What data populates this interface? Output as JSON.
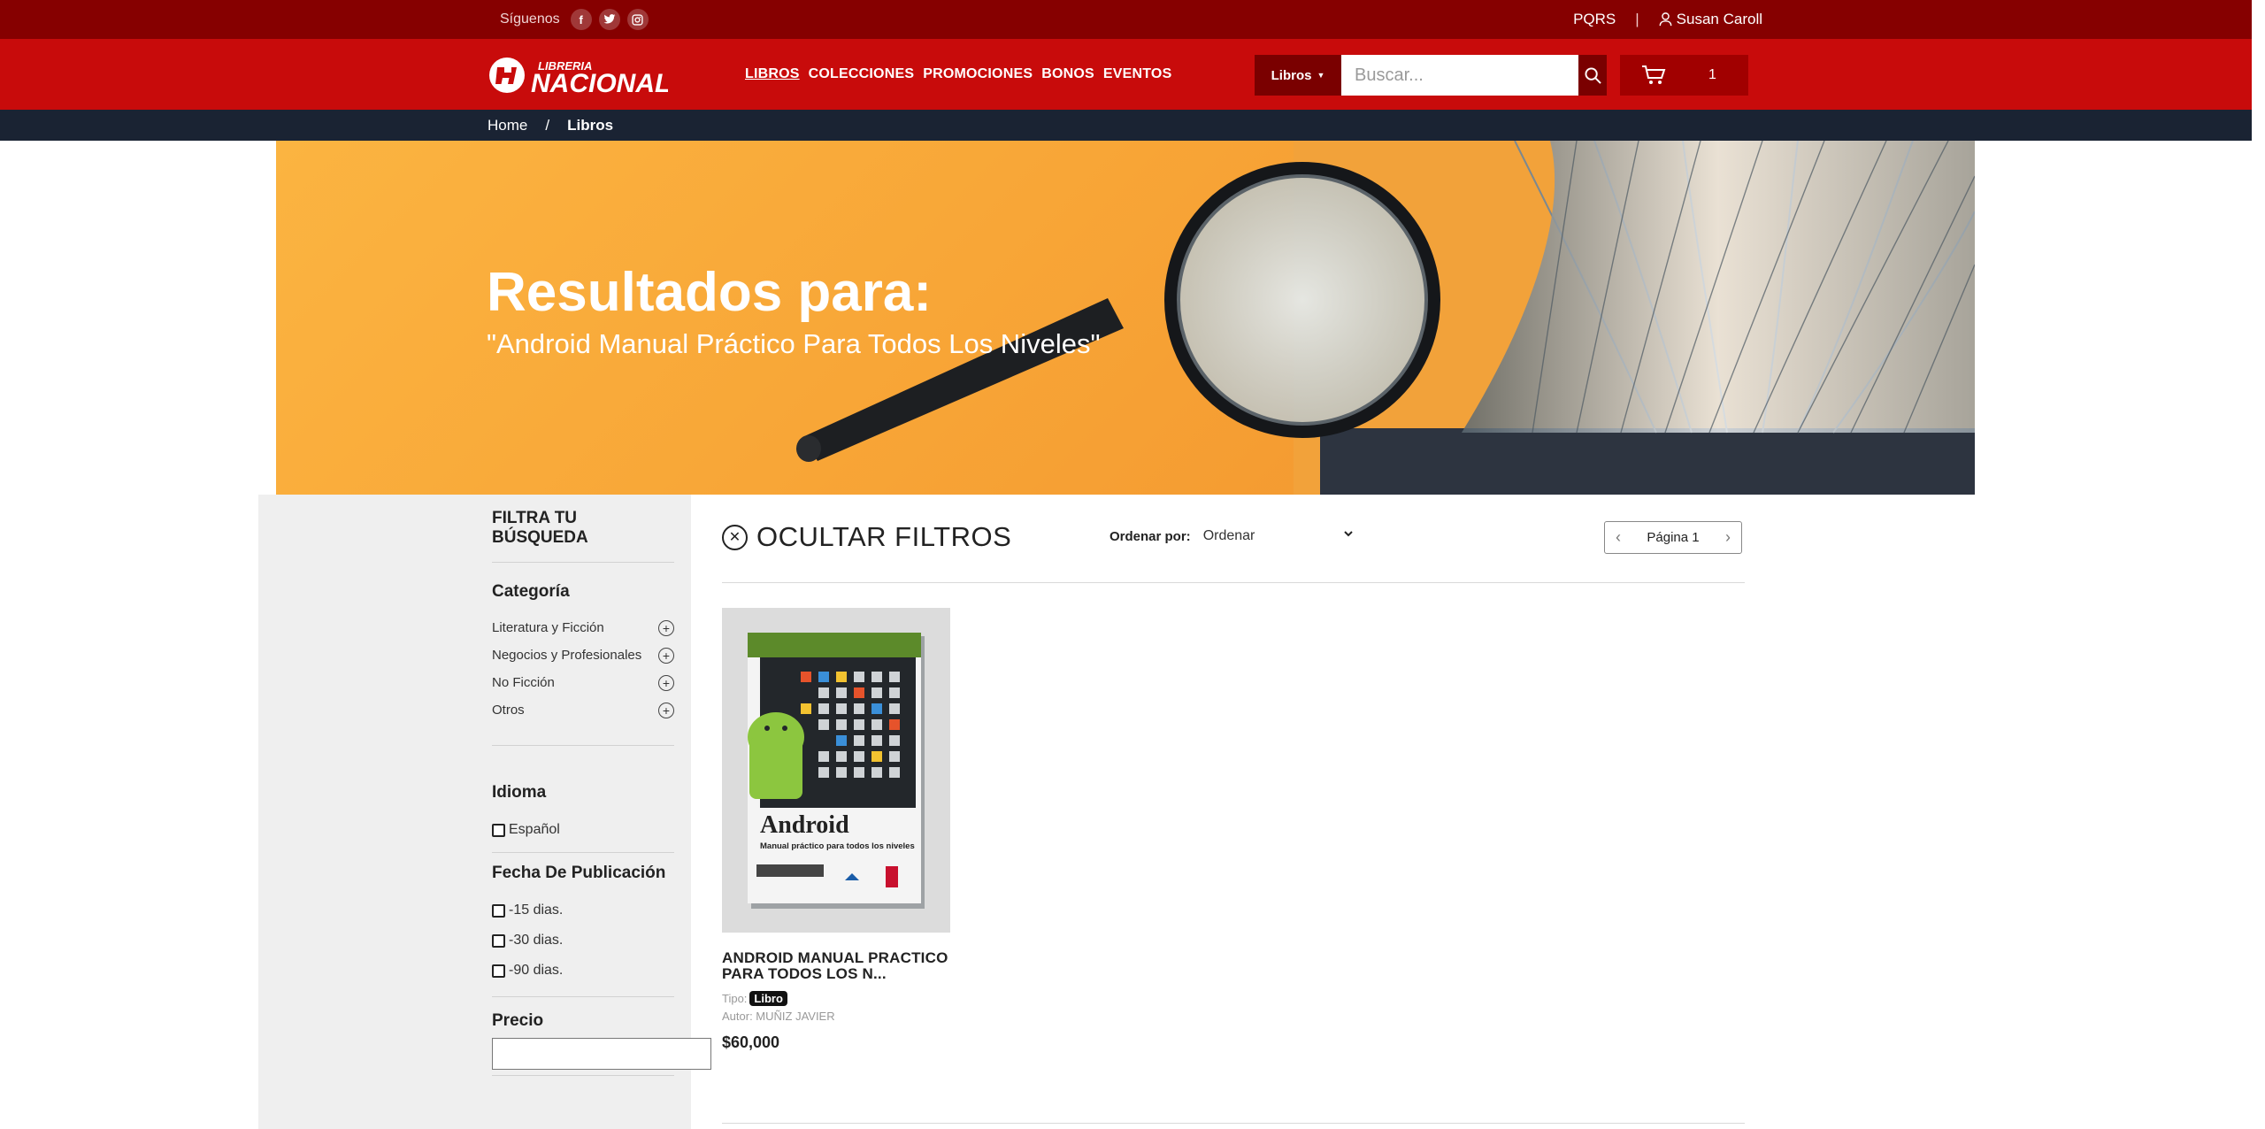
{
  "topbar": {
    "follow_label": "Síguenos",
    "social": [
      "facebook-icon",
      "twitter-icon",
      "instagram-icon"
    ],
    "pqrs": "PQRS",
    "separator": "|",
    "user_name": "Susan Caroll"
  },
  "header": {
    "logo_top": "LIBRERIA",
    "logo_main": "NACIONAL",
    "nav": [
      "LIBROS",
      "COLECCIONES",
      "PROMOCIONES",
      "BONOS",
      "EVENTOS"
    ],
    "search_category": "Libros",
    "search_placeholder": "Buscar...",
    "cart_count": "1"
  },
  "breadcrumb": {
    "home": "Home",
    "sep": "/",
    "current": "Libros"
  },
  "banner": {
    "title": "Resultados para:",
    "query": "\"Android Manual Práctico Para Todos Los Niveles\""
  },
  "filters": {
    "title": "FILTRA TU BÚSQUEDA",
    "category_heading": "Categoría",
    "categories": [
      "Literatura y Ficción",
      "Negocios y Profesionales",
      "No Ficción",
      "Otros"
    ],
    "language_heading": "Idioma",
    "languages": [
      "Español"
    ],
    "date_heading": "Fecha De Publicación",
    "dates": [
      "-15 dias.",
      "-30 dias.",
      "-90 dias."
    ],
    "price_heading": "Precio"
  },
  "results": {
    "hide_filters": "OCULTAR FILTROS",
    "order_label": "Ordenar por:",
    "order_value": "Ordenar",
    "page_label": "Página 1"
  },
  "product": {
    "title": "ANDROID MANUAL PRACTICO PARA TODOS LOS N...",
    "type_label": "Tipo:",
    "type_value": "Libro",
    "author": "Autor: MUÑIZ JAVIER",
    "price": "$60,000",
    "cover_title": "Android",
    "cover_subtitle": "Manual práctico para todos los niveles"
  },
  "colors": {
    "topbar": "#860000",
    "header": "#c80b0b",
    "breadcrumb": "#1a2333",
    "banner": "#f8a637"
  }
}
